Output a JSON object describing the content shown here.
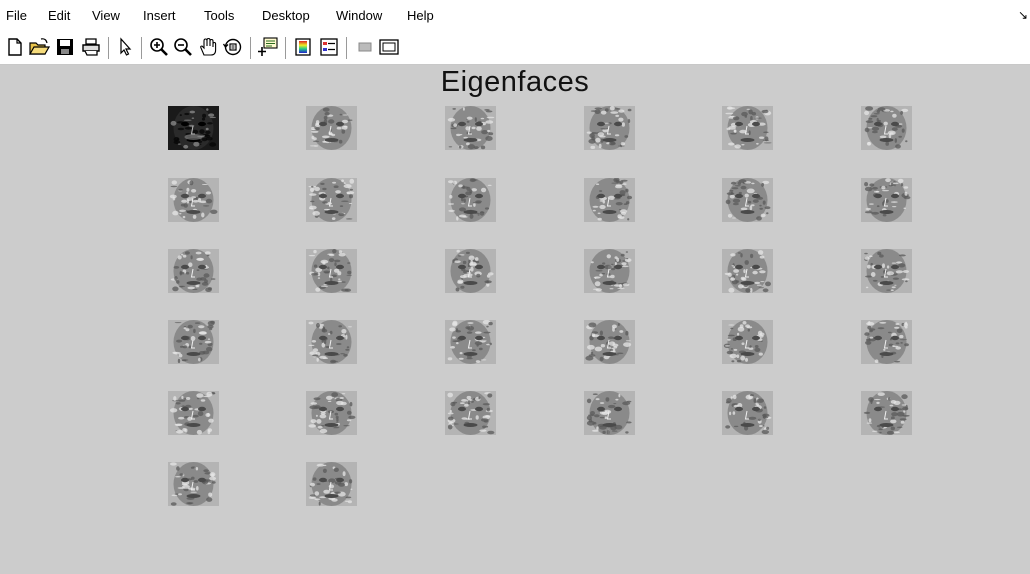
{
  "menubar": {
    "items": [
      "File",
      "Edit",
      "View",
      "Insert",
      "Tools",
      "Desktop",
      "Window",
      "Help"
    ],
    "dock_icon": "dock-arrow-icon"
  },
  "toolbar": {
    "tools": [
      {
        "name": "new-figure-icon"
      },
      {
        "name": "open-file-icon"
      },
      {
        "name": "save-figure-icon"
      },
      {
        "name": "print-figure-icon"
      },
      {
        "name": "edit-plot-icon"
      },
      {
        "name": "zoom-in-icon"
      },
      {
        "name": "zoom-out-icon"
      },
      {
        "name": "pan-icon"
      },
      {
        "name": "rotate-3d-icon"
      },
      {
        "name": "data-cursor-icon"
      },
      {
        "name": "insert-colorbar-icon"
      },
      {
        "name": "insert-legend-icon"
      },
      {
        "name": "hide-plot-tools-icon"
      },
      {
        "name": "show-plot-tools-icon"
      }
    ]
  },
  "figure": {
    "title": "Eigenfaces",
    "eigenface_count": 32,
    "columns": 6
  },
  "colors": {
    "figure_background": "#cccccc",
    "menubar_background": "#ffffff"
  }
}
